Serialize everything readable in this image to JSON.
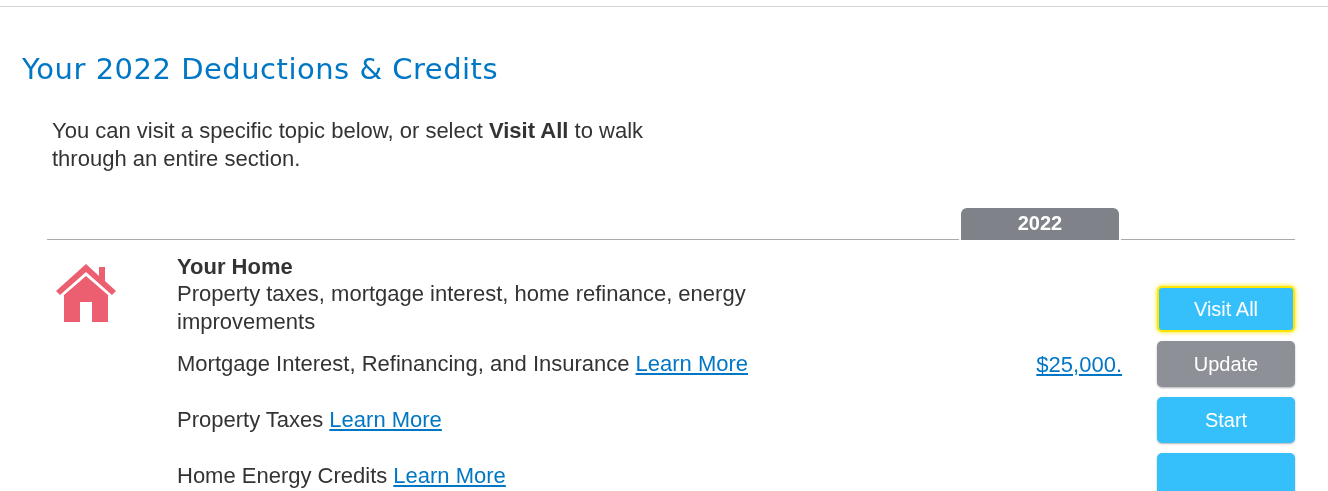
{
  "title": "Your 2022 Deductions & Credits",
  "intro": "You can visit a specific topic below, or select **Visit All** to walk through an entire section.",
  "year_tab": "2022",
  "sections": [
    {
      "title": "Your Home",
      "description": "Property taxes, mortgage interest, home refinance, energy improvements",
      "visit_all": {
        "label": "Visit All",
        "focused": true
      },
      "items": [
        {
          "label": "Mortgage Interest, Refinancing, and Insurance",
          "link": "Learn More",
          "amount": "$25,000.",
          "button": {
            "kind": "update",
            "label": "Update"
          }
        },
        {
          "label": "Property Taxes",
          "link": "Learn More",
          "button": {
            "kind": "start",
            "label": "Start"
          }
        },
        {
          "label": "Home Energy Credits",
          "link": "Learn More",
          "button": {
            "kind": "start"
          }
        }
      ]
    }
  ]
}
